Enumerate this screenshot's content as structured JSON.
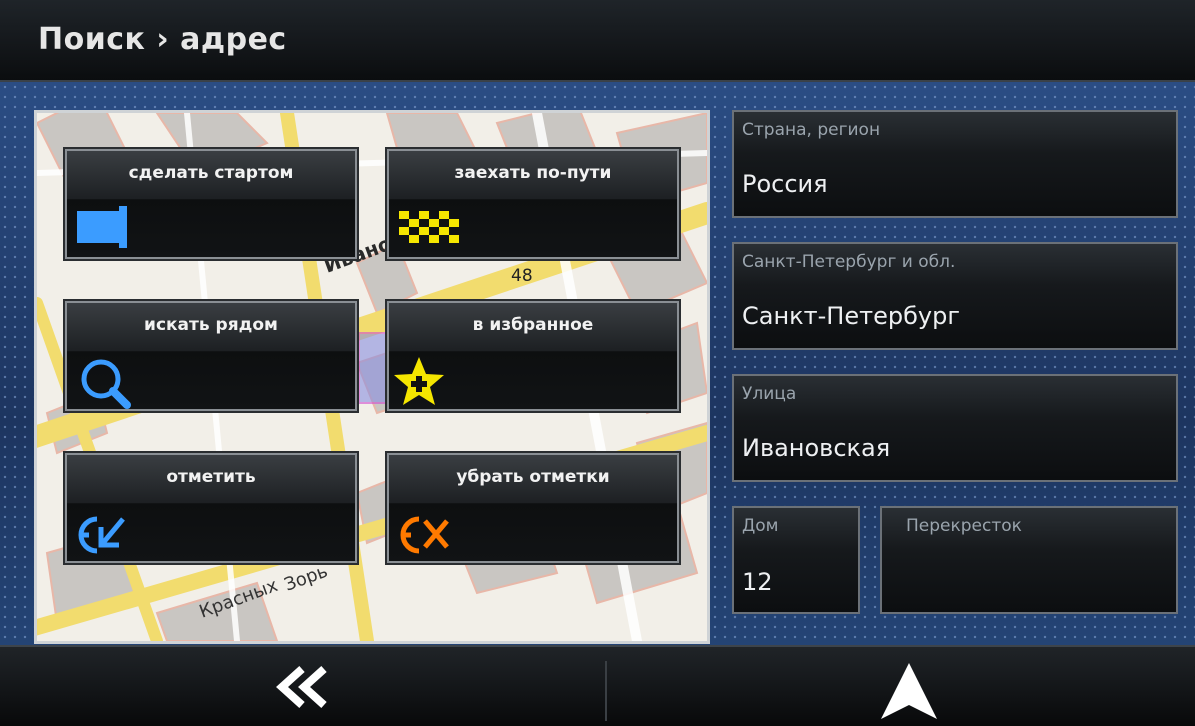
{
  "header": {
    "title": "Поиск › адрес"
  },
  "map": {
    "street_label": "Ивановская",
    "street_label2": "Зорь",
    "street_label3": "Красных",
    "building_number": "48"
  },
  "actions": [
    {
      "label": "сделать стартом",
      "icon": "start-flag-icon",
      "color": "#3b9cff"
    },
    {
      "label": "заехать по-пути",
      "icon": "checkered-flag-icon",
      "color": "#f5e600"
    },
    {
      "label": "искать рядом",
      "icon": "search-icon",
      "color": "#3b9cff"
    },
    {
      "label": "в избранное",
      "icon": "favorite-star-icon",
      "color": "#f5e600"
    },
    {
      "label": "отметить",
      "icon": "mark-icon",
      "color": "#3b9cff"
    },
    {
      "label": "убрать отметки",
      "icon": "remove-marks-icon",
      "color": "#ff7a00"
    }
  ],
  "address": {
    "country": {
      "label": "Страна, регион",
      "value": "Россия"
    },
    "city": {
      "label": "Санкт-Петербург и обл.",
      "value": "Санкт-Петербург"
    },
    "street": {
      "label": "Улица",
      "value": "Ивановская"
    },
    "house": {
      "label": "Дом",
      "value": "12"
    },
    "crossing": {
      "label": "Перекресток",
      "value": ""
    }
  },
  "footer": {
    "back_icon": "double-chevron-left-icon",
    "navigate_icon": "navigate-arrow-icon"
  }
}
